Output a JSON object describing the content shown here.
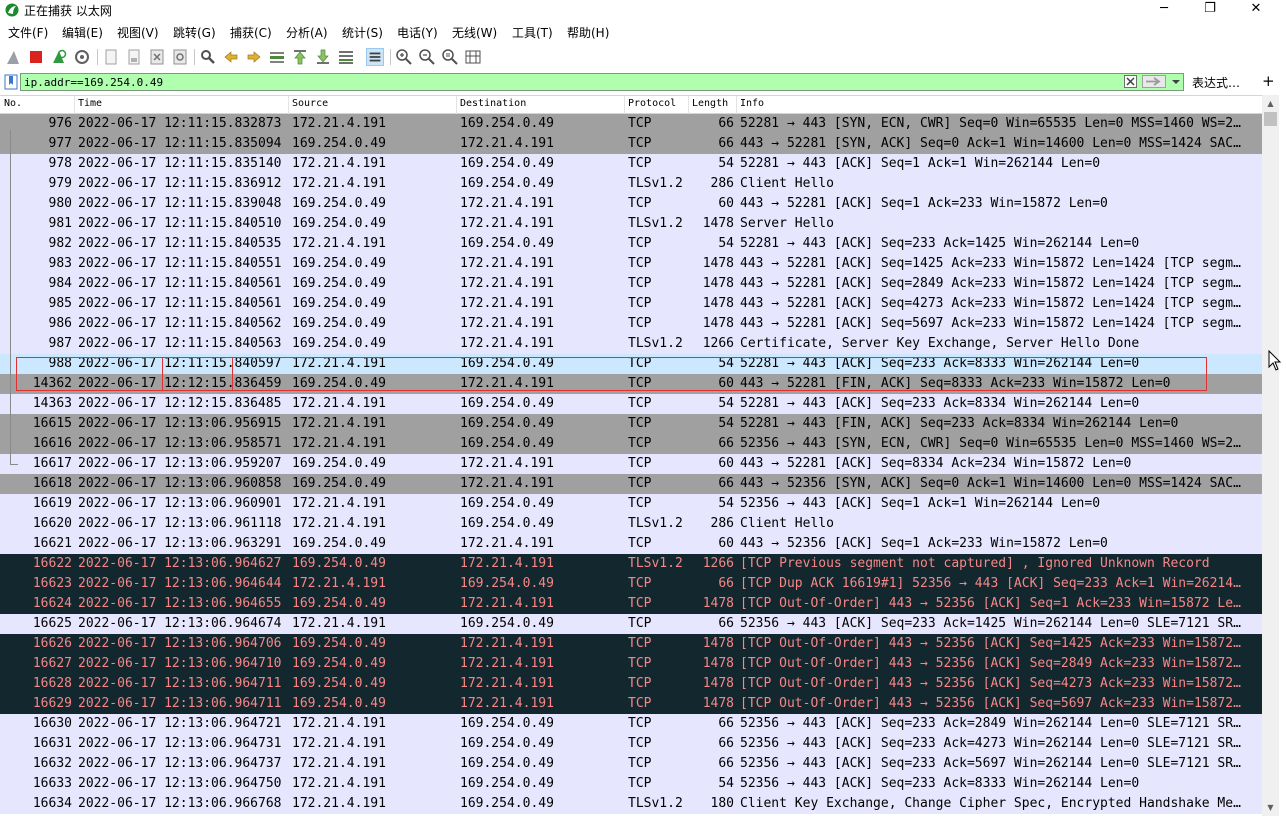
{
  "window": {
    "title": "正在捕获 以太网",
    "minimize_glyph": "─",
    "maximize_glyph": "❐",
    "close_glyph": "✕"
  },
  "menu": [
    "文件(F)",
    "编辑(E)",
    "视图(V)",
    "跳转(G)",
    "捕获(C)",
    "分析(A)",
    "统计(S)",
    "电话(Y)",
    "无线(W)",
    "工具(T)",
    "帮助(H)"
  ],
  "toolbar": {
    "icons": [
      "shark-fin-start-icon",
      "stop-capture-icon",
      "restart-capture-icon",
      "capture-options-icon",
      "open-file-icon",
      "save-file-icon",
      "close-file-icon",
      "reload-file-icon",
      "find-packet-icon",
      "go-back-icon",
      "go-forward-icon",
      "go-to-packet-icon",
      "go-first-icon",
      "go-last-icon",
      "autoscroll-icon",
      "colorize-icon",
      "zoom-in-icon",
      "zoom-out-icon",
      "zoom-normal-icon",
      "resize-columns-icon"
    ]
  },
  "filter": {
    "value": "ip.addr==169.254.0.49",
    "expression_label": "表达式…",
    "add_label": "+"
  },
  "columns": [
    "No.",
    "Time",
    "Source",
    "Destination",
    "Protocol",
    "Length",
    "Info"
  ],
  "colors": {
    "tcp_syn_fin_bg": "#a0a0a0",
    "tcp_bg": "#e7e6ff",
    "bad_bg": "#12272e",
    "bad_fg": "#f78787",
    "selected_bg": "#cce8ff",
    "highlight_box": "#e03030",
    "filter_valid_bg": "#afffaf"
  },
  "packets": [
    {
      "no": "976",
      "time": "2022-06-17 12:11:15.832873",
      "src": "172.21.4.191",
      "dst": "169.254.0.49",
      "proto": "TCP",
      "len": "66",
      "info": "52281 → 443 [SYN, ECN, CWR] Seq=0 Win=65535 Len=0 MSS=1460 WS=2…",
      "style": "gray"
    },
    {
      "no": "977",
      "time": "2022-06-17 12:11:15.835094",
      "src": "169.254.0.49",
      "dst": "172.21.4.191",
      "proto": "TCP",
      "len": "66",
      "info": "443 → 52281 [SYN, ACK] Seq=0 Ack=1 Win=14600 Len=0 MSS=1424 SAC…",
      "style": "gray"
    },
    {
      "no": "978",
      "time": "2022-06-17 12:11:15.835140",
      "src": "172.21.4.191",
      "dst": "169.254.0.49",
      "proto": "TCP",
      "len": "54",
      "info": "52281 → 443 [ACK] Seq=1 Ack=1 Win=262144 Len=0",
      "style": "tcp"
    },
    {
      "no": "979",
      "time": "2022-06-17 12:11:15.836912",
      "src": "172.21.4.191",
      "dst": "169.254.0.49",
      "proto": "TLSv1.2",
      "len": "286",
      "info": "Client Hello",
      "style": "tcp"
    },
    {
      "no": "980",
      "time": "2022-06-17 12:11:15.839048",
      "src": "169.254.0.49",
      "dst": "172.21.4.191",
      "proto": "TCP",
      "len": "60",
      "info": "443 → 52281 [ACK] Seq=1 Ack=233 Win=15872 Len=0",
      "style": "tcp"
    },
    {
      "no": "981",
      "time": "2022-06-17 12:11:15.840510",
      "src": "169.254.0.49",
      "dst": "172.21.4.191",
      "proto": "TLSv1.2",
      "len": "1478",
      "info": "Server Hello",
      "style": "tcp"
    },
    {
      "no": "982",
      "time": "2022-06-17 12:11:15.840535",
      "src": "172.21.4.191",
      "dst": "169.254.0.49",
      "proto": "TCP",
      "len": "54",
      "info": "52281 → 443 [ACK] Seq=233 Ack=1425 Win=262144 Len=0",
      "style": "tcp"
    },
    {
      "no": "983",
      "time": "2022-06-17 12:11:15.840551",
      "src": "169.254.0.49",
      "dst": "172.21.4.191",
      "proto": "TCP",
      "len": "1478",
      "info": "443 → 52281 [ACK] Seq=1425 Ack=233 Win=15872 Len=1424 [TCP segm…",
      "style": "tcp"
    },
    {
      "no": "984",
      "time": "2022-06-17 12:11:15.840561",
      "src": "169.254.0.49",
      "dst": "172.21.4.191",
      "proto": "TCP",
      "len": "1478",
      "info": "443 → 52281 [ACK] Seq=2849 Ack=233 Win=15872 Len=1424 [TCP segm…",
      "style": "tcp"
    },
    {
      "no": "985",
      "time": "2022-06-17 12:11:15.840561",
      "src": "169.254.0.49",
      "dst": "172.21.4.191",
      "proto": "TCP",
      "len": "1478",
      "info": "443 → 52281 [ACK] Seq=4273 Ack=233 Win=15872 Len=1424 [TCP segm…",
      "style": "tcp"
    },
    {
      "no": "986",
      "time": "2022-06-17 12:11:15.840562",
      "src": "169.254.0.49",
      "dst": "172.21.4.191",
      "proto": "TCP",
      "len": "1478",
      "info": "443 → 52281 [ACK] Seq=5697 Ack=233 Win=15872 Len=1424 [TCP segm…",
      "style": "tcp"
    },
    {
      "no": "987",
      "time": "2022-06-17 12:11:15.840563",
      "src": "169.254.0.49",
      "dst": "172.21.4.191",
      "proto": "TLSv1.2",
      "len": "1266",
      "info": "Certificate, Server Key Exchange, Server Hello Done",
      "style": "tcp"
    },
    {
      "no": "988",
      "time": "2022-06-17 12:11:15.840597",
      "src": "172.21.4.191",
      "dst": "169.254.0.49",
      "proto": "TCP",
      "len": "54",
      "info": "52281 → 443 [ACK] Seq=233 Ack=8333 Win=262144 Len=0",
      "style": "selected"
    },
    {
      "no": "14362",
      "time": "2022-06-17 12:12:15.836459",
      "src": "169.254.0.49",
      "dst": "172.21.4.191",
      "proto": "TCP",
      "len": "60",
      "info": "443 → 52281 [FIN, ACK] Seq=8333 Ack=233 Win=15872 Len=0",
      "style": "gray"
    },
    {
      "no": "14363",
      "time": "2022-06-17 12:12:15.836485",
      "src": "172.21.4.191",
      "dst": "169.254.0.49",
      "proto": "TCP",
      "len": "54",
      "info": "52281 → 443 [ACK] Seq=233 Ack=8334 Win=262144 Len=0",
      "style": "tcp"
    },
    {
      "no": "16615",
      "time": "2022-06-17 12:13:06.956915",
      "src": "172.21.4.191",
      "dst": "169.254.0.49",
      "proto": "TCP",
      "len": "54",
      "info": "52281 → 443 [FIN, ACK] Seq=233 Ack=8334 Win=262144 Len=0",
      "style": "gray"
    },
    {
      "no": "16616",
      "time": "2022-06-17 12:13:06.958571",
      "src": "172.21.4.191",
      "dst": "169.254.0.49",
      "proto": "TCP",
      "len": "66",
      "info": "52356 → 443 [SYN, ECN, CWR] Seq=0 Win=65535 Len=0 MSS=1460 WS=2…",
      "style": "gray"
    },
    {
      "no": "16617",
      "time": "2022-06-17 12:13:06.959207",
      "src": "169.254.0.49",
      "dst": "172.21.4.191",
      "proto": "TCP",
      "len": "60",
      "info": "443 → 52281 [ACK] Seq=8334 Ack=234 Win=15872 Len=0",
      "style": "tcp"
    },
    {
      "no": "16618",
      "time": "2022-06-17 12:13:06.960858",
      "src": "169.254.0.49",
      "dst": "172.21.4.191",
      "proto": "TCP",
      "len": "66",
      "info": "443 → 52356 [SYN, ACK] Seq=0 Ack=1 Win=14600 Len=0 MSS=1424 SAC…",
      "style": "gray"
    },
    {
      "no": "16619",
      "time": "2022-06-17 12:13:06.960901",
      "src": "172.21.4.191",
      "dst": "169.254.0.49",
      "proto": "TCP",
      "len": "54",
      "info": "52356 → 443 [ACK] Seq=1 Ack=1 Win=262144 Len=0",
      "style": "tcp"
    },
    {
      "no": "16620",
      "time": "2022-06-17 12:13:06.961118",
      "src": "172.21.4.191",
      "dst": "169.254.0.49",
      "proto": "TLSv1.2",
      "len": "286",
      "info": "Client Hello",
      "style": "tcp"
    },
    {
      "no": "16621",
      "time": "2022-06-17 12:13:06.963291",
      "src": "169.254.0.49",
      "dst": "172.21.4.191",
      "proto": "TCP",
      "len": "60",
      "info": "443 → 52356 [ACK] Seq=1 Ack=233 Win=15872 Len=0",
      "style": "tcp"
    },
    {
      "no": "16622",
      "time": "2022-06-17 12:13:06.964627",
      "src": "169.254.0.49",
      "dst": "172.21.4.191",
      "proto": "TLSv1.2",
      "len": "1266",
      "info": "[TCP Previous segment not captured] , Ignored Unknown Record",
      "style": "bad"
    },
    {
      "no": "16623",
      "time": "2022-06-17 12:13:06.964644",
      "src": "172.21.4.191",
      "dst": "169.254.0.49",
      "proto": "TCP",
      "len": "66",
      "info": "[TCP Dup ACK 16619#1] 52356 → 443 [ACK] Seq=233 Ack=1 Win=26214…",
      "style": "bad"
    },
    {
      "no": "16624",
      "time": "2022-06-17 12:13:06.964655",
      "src": "169.254.0.49",
      "dst": "172.21.4.191",
      "proto": "TCP",
      "len": "1478",
      "info": "[TCP Out-Of-Order] 443 → 52356 [ACK] Seq=1 Ack=233 Win=15872 Le…",
      "style": "bad"
    },
    {
      "no": "16625",
      "time": "2022-06-17 12:13:06.964674",
      "src": "172.21.4.191",
      "dst": "169.254.0.49",
      "proto": "TCP",
      "len": "66",
      "info": "52356 → 443 [ACK] Seq=233 Ack=1425 Win=262144 Len=0 SLE=7121 SR…",
      "style": "tcp"
    },
    {
      "no": "16626",
      "time": "2022-06-17 12:13:06.964706",
      "src": "169.254.0.49",
      "dst": "172.21.4.191",
      "proto": "TCP",
      "len": "1478",
      "info": "[TCP Out-Of-Order] 443 → 52356 [ACK] Seq=1425 Ack=233 Win=15872…",
      "style": "bad"
    },
    {
      "no": "16627",
      "time": "2022-06-17 12:13:06.964710",
      "src": "169.254.0.49",
      "dst": "172.21.4.191",
      "proto": "TCP",
      "len": "1478",
      "info": "[TCP Out-Of-Order] 443 → 52356 [ACK] Seq=2849 Ack=233 Win=15872…",
      "style": "bad"
    },
    {
      "no": "16628",
      "time": "2022-06-17 12:13:06.964711",
      "src": "169.254.0.49",
      "dst": "172.21.4.191",
      "proto": "TCP",
      "len": "1478",
      "info": "[TCP Out-Of-Order] 443 → 52356 [ACK] Seq=4273 Ack=233 Win=15872…",
      "style": "bad"
    },
    {
      "no": "16629",
      "time": "2022-06-17 12:13:06.964711",
      "src": "169.254.0.49",
      "dst": "172.21.4.191",
      "proto": "TCP",
      "len": "1478",
      "info": "[TCP Out-Of-Order] 443 → 52356 [ACK] Seq=5697 Ack=233 Win=15872…",
      "style": "bad"
    },
    {
      "no": "16630",
      "time": "2022-06-17 12:13:06.964721",
      "src": "172.21.4.191",
      "dst": "169.254.0.49",
      "proto": "TCP",
      "len": "66",
      "info": "52356 → 443 [ACK] Seq=233 Ack=2849 Win=262144 Len=0 SLE=7121 SR…",
      "style": "tcp"
    },
    {
      "no": "16631",
      "time": "2022-06-17 12:13:06.964731",
      "src": "172.21.4.191",
      "dst": "169.254.0.49",
      "proto": "TCP",
      "len": "66",
      "info": "52356 → 443 [ACK] Seq=233 Ack=4273 Win=262144 Len=0 SLE=7121 SR…",
      "style": "tcp"
    },
    {
      "no": "16632",
      "time": "2022-06-17 12:13:06.964737",
      "src": "172.21.4.191",
      "dst": "169.254.0.49",
      "proto": "TCP",
      "len": "66",
      "info": "52356 → 443 [ACK] Seq=233 Ack=5697 Win=262144 Len=0 SLE=7121 SR…",
      "style": "tcp"
    },
    {
      "no": "16633",
      "time": "2022-06-17 12:13:06.964750",
      "src": "172.21.4.191",
      "dst": "169.254.0.49",
      "proto": "TCP",
      "len": "54",
      "info": "52356 → 443 [ACK] Seq=233 Ack=8333 Win=262144 Len=0",
      "style": "tcp"
    },
    {
      "no": "16634",
      "time": "2022-06-17 12:13:06.966768",
      "src": "172.21.4.191",
      "dst": "169.254.0.49",
      "proto": "TLSv1.2",
      "len": "180",
      "info": "Client Key Exchange, Change Cipher Spec, Encrypted Handshake Me…",
      "style": "tcp"
    }
  ]
}
